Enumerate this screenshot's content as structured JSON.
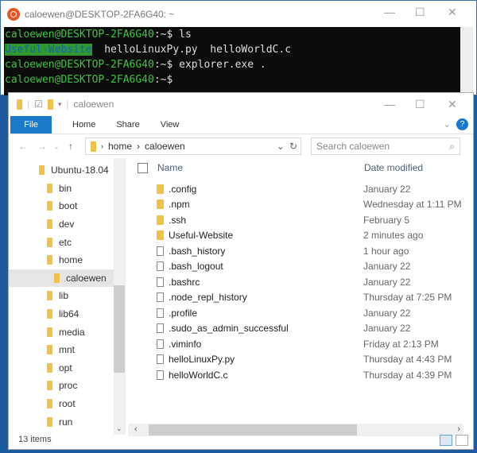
{
  "terminal": {
    "title": "caloewen@DESKTOP-2FA6G40: ~",
    "lines": [
      {
        "prompt": "caloewen@DESKTOP-2FA6G40",
        "path": ":~$",
        "cmd": " ls"
      },
      {
        "highlight": "Useful-Website",
        "rest": "  helloLinuxPy.py  helloWorldC.c"
      },
      {
        "prompt": "caloewen@DESKTOP-2FA6G40",
        "path": ":~$",
        "cmd": " explorer.exe ."
      },
      {
        "prompt": "caloewen@DESKTOP-2FA6G40",
        "path": ":~$",
        "cmd": ""
      }
    ]
  },
  "explorer": {
    "title": "caloewen",
    "tabs": [
      "File",
      "Home",
      "Share",
      "View"
    ],
    "address": [
      "home",
      "caloewen"
    ],
    "search_placeholder": "Search caloewen",
    "nav": [
      "Ubuntu-18.04",
      "bin",
      "boot",
      "dev",
      "etc",
      "home",
      "caloewen",
      "lib",
      "lib64",
      "media",
      "mnt",
      "opt",
      "proc",
      "root",
      "run"
    ],
    "columns": {
      "name": "Name",
      "date": "Date modified"
    },
    "files": [
      {
        "name": ".config",
        "date": "January 22",
        "type": "folder"
      },
      {
        "name": ".npm",
        "date": "Wednesday at 1:11 PM",
        "type": "folder"
      },
      {
        "name": ".ssh",
        "date": "February 5",
        "type": "folder"
      },
      {
        "name": "Useful-Website",
        "date": "2 minutes ago",
        "type": "folder"
      },
      {
        "name": ".bash_history",
        "date": "1 hour ago",
        "type": "file"
      },
      {
        "name": ".bash_logout",
        "date": "January 22",
        "type": "file"
      },
      {
        "name": ".bashrc",
        "date": "January 22",
        "type": "file"
      },
      {
        "name": ".node_repl_history",
        "date": "Thursday at 7:25 PM",
        "type": "file"
      },
      {
        "name": ".profile",
        "date": "January 22",
        "type": "file"
      },
      {
        "name": ".sudo_as_admin_successful",
        "date": "January 22",
        "type": "file"
      },
      {
        "name": ".viminfo",
        "date": "Friday at 2:13 PM",
        "type": "file"
      },
      {
        "name": "helloLinuxPy.py",
        "date": "Thursday at 4:43 PM",
        "type": "file"
      },
      {
        "name": "helloWorldC.c",
        "date": "Thursday at 4:39 PM",
        "type": "file"
      }
    ],
    "status": "13 items"
  }
}
